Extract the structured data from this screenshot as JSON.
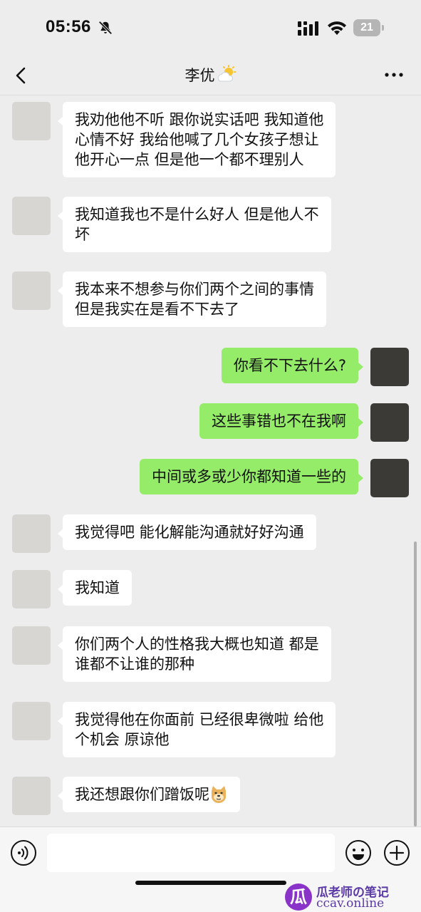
{
  "status_bar": {
    "time": "05:56",
    "battery_level": "21"
  },
  "nav": {
    "title": "李优"
  },
  "messages": [
    {
      "side": "left",
      "text": "我劝他他不听  跟你说实话吧 我知道他\n心情不好 我给他喊了几个女孩子想让\n他开心一点 但是他一个都不理别人"
    },
    {
      "side": "left",
      "text": "我知道我也不是什么好人 但是他人不\n坏"
    },
    {
      "side": "left",
      "text": "我本来不想参与你们两个之间的事情\n但是我实在是看不下去了"
    },
    {
      "side": "right",
      "text": "你看不下去什么?"
    },
    {
      "side": "right",
      "text": "这些事错也不在我啊"
    },
    {
      "side": "right",
      "text": "中间或多或少你都知道一些的"
    },
    {
      "side": "left",
      "text": "我觉得吧 能化解能沟通就好好沟通"
    },
    {
      "side": "left",
      "text": "我知道"
    },
    {
      "side": "left",
      "text": "你们两个人的性格我大概也知道 都是\n谁都不让谁的那种"
    },
    {
      "side": "left",
      "text": "我觉得他在你面前 已经很卑微啦 给他\n个机会  原谅他"
    },
    {
      "side": "left",
      "text": "我还想跟你们蹭饭呢"
    }
  ],
  "watermark": {
    "logo": "瓜",
    "line1": "瓜老师の笔记",
    "line2": "ccav.online"
  },
  "icons": {
    "bell": "bell-slash-icon",
    "signal": "cellular-signal-icon",
    "wifi": "wifi-icon",
    "battery": "battery-icon",
    "back": "chevron-left-icon",
    "title_emoji": "sun-cloud-emoji",
    "more": "more-dots-icon",
    "doge": "doge-emoji",
    "voice": "voice-icon",
    "emoji": "emoji-icon",
    "plus": "plus-icon"
  },
  "colors": {
    "background": "#ededed",
    "own_bubble": "#95ec69",
    "other_bubble": "#ffffff",
    "input_bar": "#f6f6f6"
  }
}
